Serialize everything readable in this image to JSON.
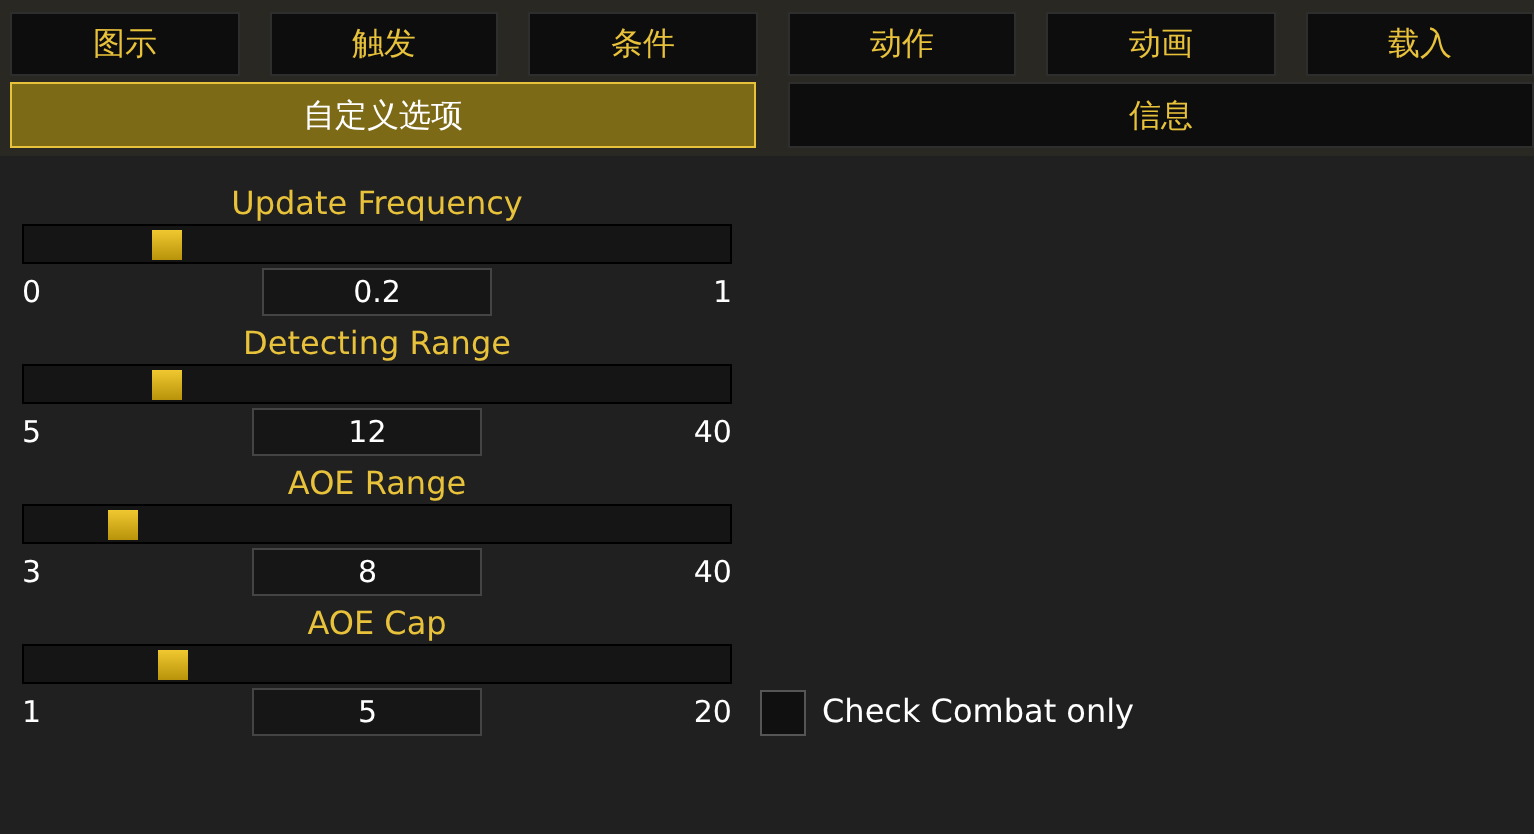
{
  "tabs": [
    {
      "label": "图示",
      "selected": false
    },
    {
      "label": "触发",
      "selected": false
    },
    {
      "label": "条件",
      "selected": false
    },
    {
      "label": "动作",
      "selected": false
    },
    {
      "label": "动画",
      "selected": false
    },
    {
      "label": "载入",
      "selected": false
    }
  ],
  "subtabs": [
    {
      "label": "自定义选项",
      "selected": true
    },
    {
      "label": "信息",
      "selected": false
    }
  ],
  "sliders": [
    {
      "label": "Update Frequency",
      "level": 0.2,
      "min": "0",
      "value": "0.2",
      "max": "1"
    },
    {
      "label": "Detecting Range",
      "level": 0.2,
      "min": "5",
      "value": "12",
      "max": "40"
    },
    {
      "label": "AOE Range",
      "level": 0.14,
      "min": "3",
      "value": "8",
      "max": "40"
    },
    {
      "label": "AOE Cap",
      "level": 0.21,
      "min": "1",
      "value": "5",
      "max": "20"
    }
  ],
  "checkbox": {
    "label": "Check Combat only",
    "checked": false
  }
}
